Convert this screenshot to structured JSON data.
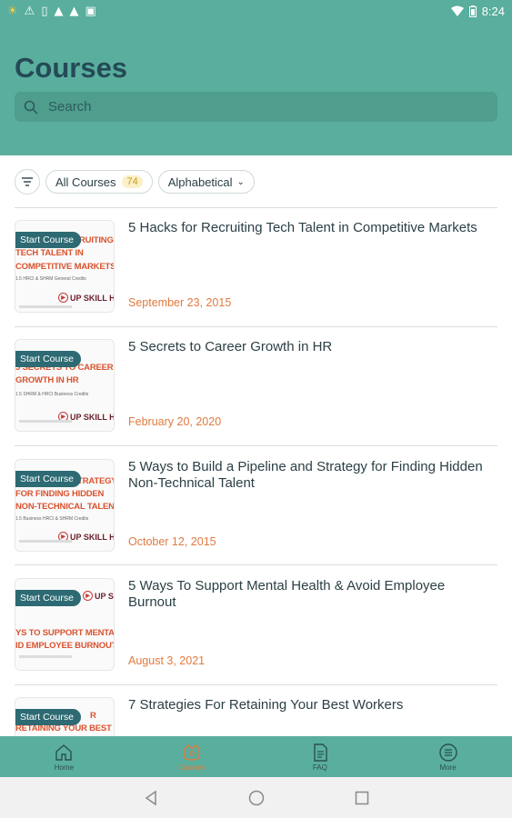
{
  "status_bar": {
    "time": "8:24",
    "icons": [
      "sun-icon",
      "warning-icon",
      "sim-icon",
      "android-icon",
      "android-icon",
      "ad-icon"
    ],
    "right_icons": [
      "wifi-icon",
      "battery-icon"
    ]
  },
  "header": {
    "title": "Courses",
    "search_placeholder": "Search"
  },
  "filters": {
    "all_courses_label": "All Courses",
    "all_courses_count": "74",
    "sort_label": "Alphabetical"
  },
  "courses": [
    {
      "title": "5 Hacks for Recruiting Tech Talent in Competitive Markets",
      "date": "September 23, 2015",
      "start_label": "Start Course",
      "thumb_lines": [
        "RUITING",
        "TECH TALENT IN",
        "COMPETITIVE MARKETS"
      ],
      "thumb_sub": "1.5 HRCI & SHRM General Credits",
      "logo": "UP SKILL H"
    },
    {
      "title": "5 Secrets to Career Growth in HR",
      "date": "February 20, 2020",
      "start_label": "Start Course",
      "thumb_lines": [
        "5 SECRETS TO CAREER",
        "GROWTH IN HR"
      ],
      "thumb_sub": "1.5 SHRM & HRCI Business Credits",
      "logo": "UP SKILL H"
    },
    {
      "title": "5 Ways to Build a Pipeline and Strategy for Finding Hidden Non-Technical Talent",
      "date": "October 12, 2015",
      "start_label": "Start Course",
      "thumb_lines": [
        "STRATEGY",
        "FOR FINDING HIDDEN",
        "NON-TECHNICAL TALENT"
      ],
      "thumb_sub": "1.5 Business HRCI & SHRM Credits",
      "logo": "UP SKILL H"
    },
    {
      "title": "5 Ways To Support Mental Health & Avoid Employee Burnout",
      "date": "August 3, 2021",
      "start_label": "Start Course",
      "thumb_lines": [
        "YS TO SUPPORT MENTAL H",
        "ID EMPLOYEE BURNOUT"
      ],
      "thumb_sub": "",
      "logo": "UP SK"
    },
    {
      "title": "7 Strategies For Retaining Your Best Workers",
      "date": "",
      "start_label": "Start Course",
      "thumb_lines": [
        "R",
        "RETAINING YOUR BEST"
      ],
      "thumb_sub": "",
      "logo": ""
    }
  ],
  "bottom_nav": [
    {
      "label": "Home",
      "icon": "home-icon"
    },
    {
      "label": "Courses",
      "icon": "courses-icon"
    },
    {
      "label": "FAQ",
      "icon": "document-icon"
    },
    {
      "label": "More",
      "icon": "menu-icon"
    }
  ],
  "colors": {
    "primary": "#5aae9d",
    "title": "#244a57",
    "accent_date": "#e07a3f",
    "start_badge": "#2d6a73"
  }
}
